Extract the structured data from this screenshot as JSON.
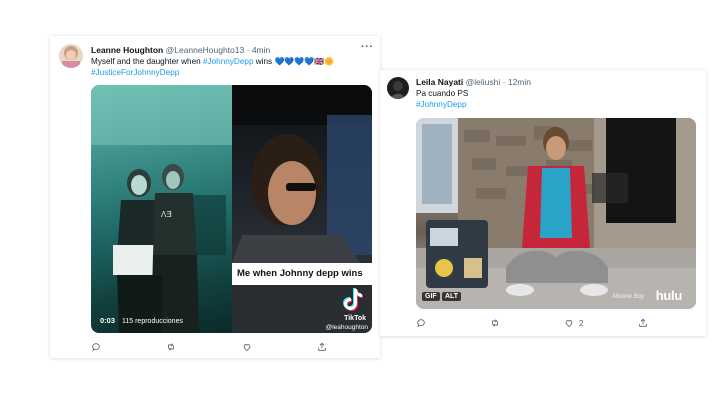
{
  "tweets": [
    {
      "display_name": "Leanne Houghton",
      "handle": "@LeanneHoughto13",
      "time": "4min",
      "text_prefix": "Myself and the daughter when ",
      "text_tag": "#JohnnyDepp",
      "text_suffix": " wins ",
      "emoji": "💙💙💙💙🇬🇧🌼",
      "hashtag_line": "#JusticeForJohnnyDepp",
      "media": {
        "caption": "Me when Johnny depp wins",
        "duration": "0:03",
        "views": "115 reproducciones",
        "brand": "TikTok",
        "brand_user": "@leahoughton"
      }
    },
    {
      "display_name": "Leila Nayati",
      "handle": "@leliushi",
      "time": "12min",
      "text": "Pa cuando PS",
      "hashtag_line": "#JohnnyDepp",
      "media": {
        "gif_label": "GIF",
        "alt_label": "ALT",
        "watermark": "hulu",
        "studio": "Moonie Boy"
      },
      "like_count": "2"
    }
  ],
  "colors": {
    "link": "#1d9bf0",
    "muted": "#536471",
    "text": "#0f1419"
  },
  "icons": [
    "more-icon",
    "reply-icon",
    "retweet-icon",
    "like-icon",
    "share-icon",
    "tiktok-icon"
  ]
}
